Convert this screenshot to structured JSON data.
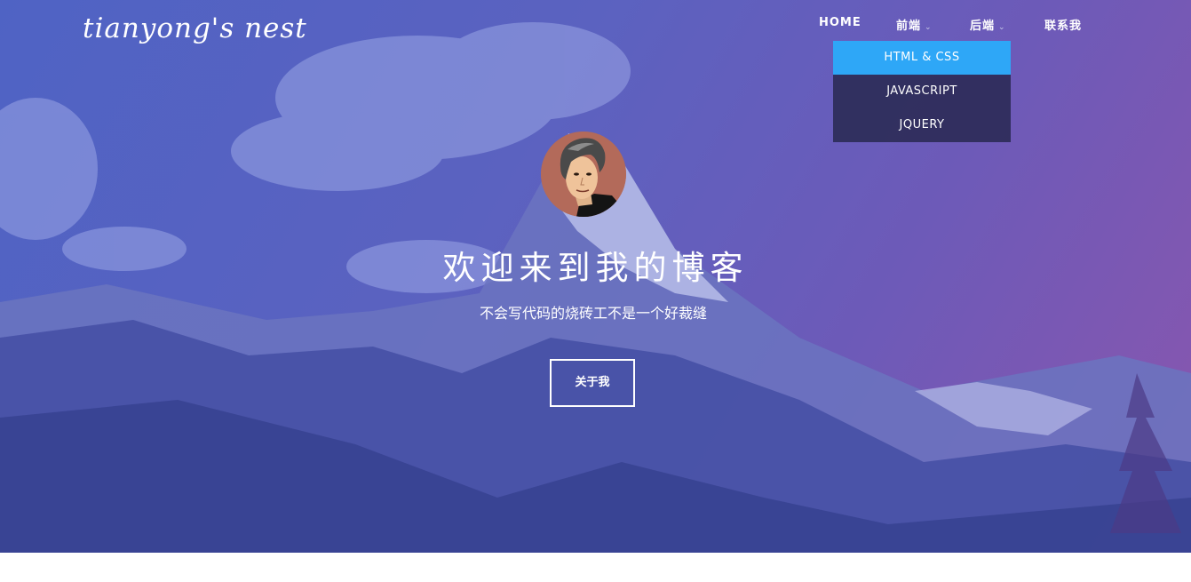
{
  "site": {
    "logo": "tianyong's nest"
  },
  "nav": {
    "items": [
      {
        "label": "HOME"
      },
      {
        "label": "前端",
        "caret": "⌄"
      },
      {
        "label": "后端",
        "caret": "⌄"
      },
      {
        "label": "联系我"
      }
    ],
    "dropdown": {
      "items": [
        {
          "label": "HTML & CSS",
          "active": true
        },
        {
          "label": "JAVASCRIPT"
        },
        {
          "label": "JQUERY"
        }
      ]
    }
  },
  "hero": {
    "title": "欢迎来到我的博客",
    "subtitle": "不会写代码的烧砖工不是一个好裁缝",
    "button_label": "关于我"
  },
  "colors": {
    "overlay_start": "#4f63c4",
    "overlay_end": "#8a56ae",
    "dropdown_active": "#2ea7f7",
    "dropdown_bg": "#2a2a50"
  }
}
